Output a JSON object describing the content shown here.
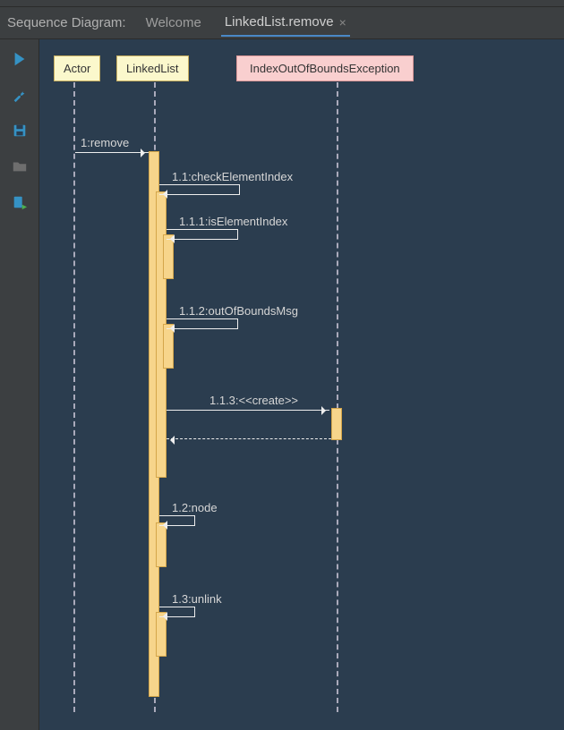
{
  "header": {
    "title": "Sequence Diagram:",
    "tabs": [
      {
        "label": "Welcome",
        "active": false
      },
      {
        "label": "LinkedList.remove",
        "active": true
      }
    ]
  },
  "sidebar": {
    "icons": [
      "play-icon",
      "wrench-icon",
      "save-icon",
      "folder-icon",
      "export-icon"
    ]
  },
  "diagram": {
    "participants": {
      "actor": "Actor",
      "linkedlist": "LinkedList",
      "exception": "IndexOutOfBoundsException"
    },
    "messages": {
      "m1": "1:remove",
      "m11": "1.1:checkElementIndex",
      "m111": "1.1.1:isElementIndex",
      "m112": "1.1.2:outOfBoundsMsg",
      "m113": "1.1.3:<<create>>",
      "m12": "1.2:node",
      "m13": "1.3:unlink"
    }
  }
}
